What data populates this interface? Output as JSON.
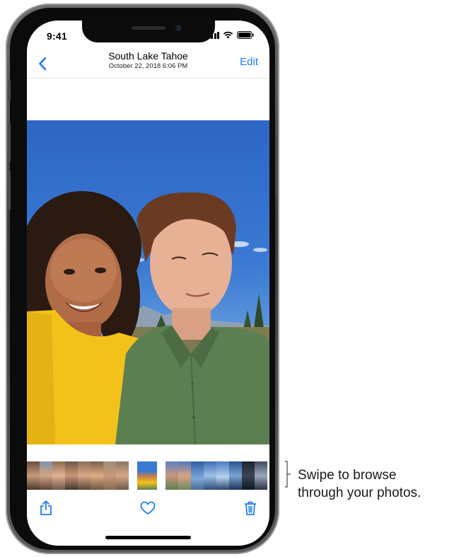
{
  "status_bar": {
    "time": "9:41"
  },
  "nav": {
    "title": "South Lake Tahoe",
    "subtitle": "October 22, 2018  6:06 PM",
    "edit_label": "Edit",
    "back_icon": "chevron-left-icon"
  },
  "photo": {
    "description_icon": "photo-view"
  },
  "toolbar": {
    "share_icon": "share-icon",
    "like_icon": "heart-icon",
    "delete_icon": "trash-icon"
  },
  "callout": {
    "line1": "Swipe to browse",
    "line2": "through your photos."
  },
  "colors": {
    "accent": "#1a7cf5",
    "sky": "#3b7ad3",
    "yellow_shirt": "#f2c21a",
    "green_shirt": "#5c7f52"
  }
}
